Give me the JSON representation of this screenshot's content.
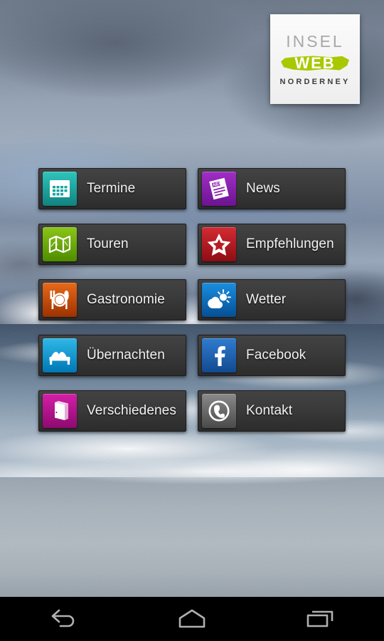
{
  "app": {
    "name": "InselWeb Norderney",
    "platform": "Android home screen"
  },
  "logo": {
    "line1": "INSEL",
    "line2": "WEB",
    "line3": "NORDERNEY",
    "brush_color": "#aac800",
    "line1_color": "#a8a8a8",
    "line3_color": "#3d3d3d",
    "card_background": "#f7f7f7"
  },
  "tiles": [
    {
      "label": "Termine",
      "icon": "calendar-icon",
      "color_top": "#2fc4bd",
      "color_bottom": "#11827f"
    },
    {
      "label": "News",
      "icon": "newspaper-icon",
      "color_top": "#a12ec6",
      "color_bottom": "#6b1490"
    },
    {
      "label": "Touren",
      "icon": "map-icon",
      "color_top": "#8bc518",
      "color_bottom": "#4e8c00"
    },
    {
      "label": "Empfehlungen",
      "icon": "star-icon",
      "color_top": "#d42b33",
      "color_bottom": "#8d0d14"
    },
    {
      "label": "Gastronomie",
      "icon": "dining-icon",
      "color_top": "#e8691a",
      "color_bottom": "#9c3200"
    },
    {
      "label": "Wetter",
      "icon": "weather-icon",
      "color_top": "#1a8fe0",
      "color_bottom": "#054f94"
    },
    {
      "label": "Übernachten",
      "icon": "bed-icon",
      "color_top": "#2fb8e8",
      "color_bottom": "#0077b4"
    },
    {
      "label": "Facebook",
      "icon": "facebook-icon",
      "color_top": "#2f7cd0",
      "color_bottom": "#12498f"
    },
    {
      "label": "Verschiedenes",
      "icon": "book-icon",
      "color_top": "#d41fa8",
      "color_bottom": "#8e0a6f"
    },
    {
      "label": "Kontakt",
      "icon": "phone-icon",
      "color_top": "#8a8a8a",
      "color_bottom": "#4a4a4a"
    }
  ],
  "navbar": {
    "back": "back-icon",
    "home": "home-icon",
    "recents": "recents-icon"
  },
  "theme": {
    "tile_background_top": "#434343",
    "tile_background_bottom": "#2c2c2c",
    "tile_label_color": "#f2f2f2",
    "navbar_background": "#000000",
    "navbar_icon_color": "#b0b0b0"
  }
}
